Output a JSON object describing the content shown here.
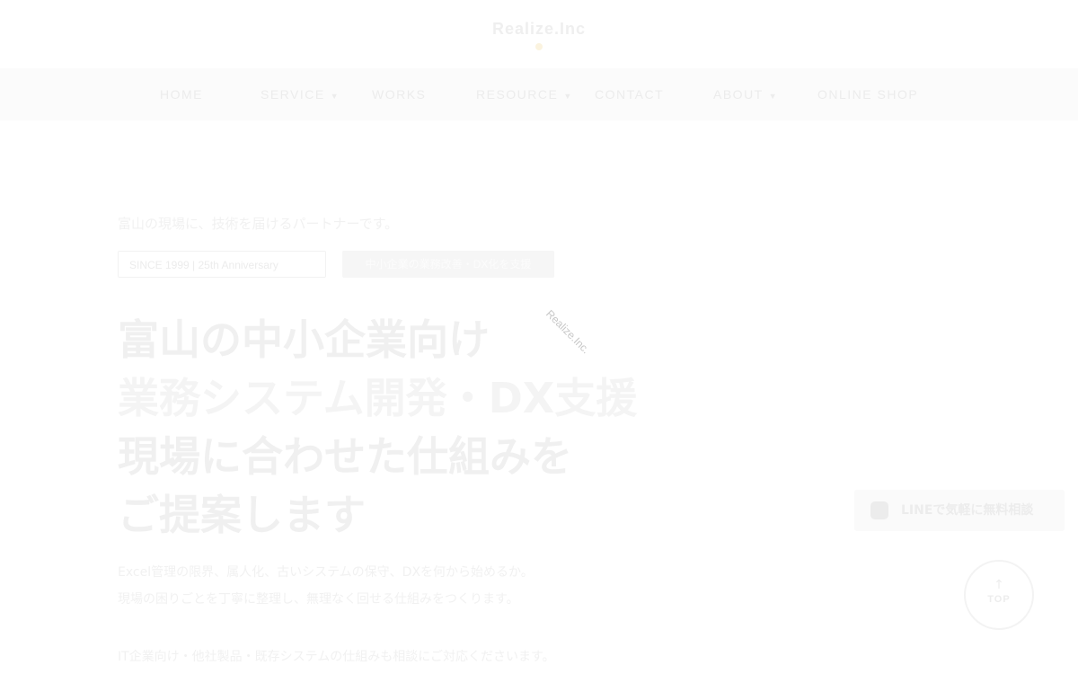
{
  "header": {
    "logo": "Realize.Inc"
  },
  "nav": {
    "items": [
      {
        "label": "HOME",
        "dropdown": false
      },
      {
        "label": "SERVICE",
        "dropdown": true
      },
      {
        "label": "WORKS",
        "dropdown": false
      },
      {
        "label": "RESOURCE",
        "dropdown": true
      },
      {
        "label": "CONTACT",
        "dropdown": false
      },
      {
        "label": "ABOUT",
        "dropdown": true
      },
      {
        "label": "ONLINE SHOP",
        "dropdown": false
      }
    ]
  },
  "hero": {
    "lead": "富山の現場に、技術を届けるパートナーです。",
    "tag_outline": "SINCE 1999 | 25th Anniversary",
    "tag_fill": "中小企業の業務改善・DX化を支援",
    "watermark": "Realize.Inc.",
    "headline": [
      "富山の中小企業向け",
      "業務システム開発・DX支援",
      "現場に合わせた仕組みを",
      "ご提案します"
    ],
    "body": [
      "Excel管理の限界、属人化、古いシステムの保守、DXを何から始めるか。",
      "現場の困りごとを丁寧に整理し、無理なく回せる仕組みをつくります。",
      "",
      "IT企業向け・他社製品・既存システムの仕組みも相談にご対応くださいます。"
    ]
  },
  "floating": {
    "line_button": "LINEで気軽に無料相談",
    "top_button": "TOP",
    "top_arrow": "↑"
  },
  "colors": {
    "background": "#ffffff",
    "nav_background": "#fbfbfb",
    "text_faint": "#f0f0f0"
  }
}
